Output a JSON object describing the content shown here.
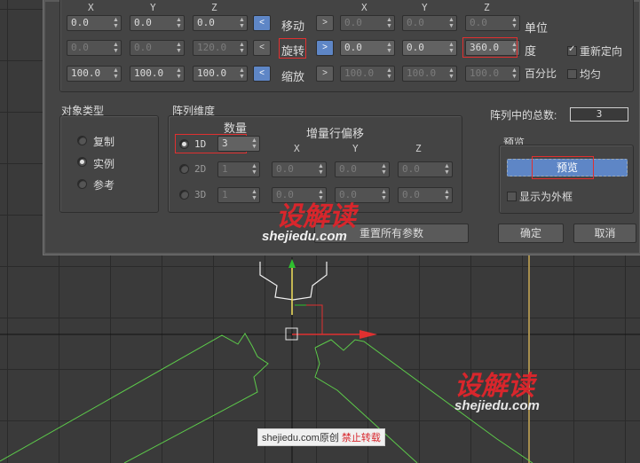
{
  "axes": {
    "x": "X",
    "y": "Y",
    "z": "Z"
  },
  "incremental": {
    "move": {
      "x": "0.0",
      "y": "0.0",
      "z": "0.0"
    },
    "rotate": {
      "x": "0.0",
      "y": "0.0",
      "z": "120.0"
    },
    "scale": {
      "x": "100.0",
      "y": "100.0",
      "z": "100.0"
    }
  },
  "row_labels": {
    "move": "移动",
    "rotate": "旋转",
    "scale": "缩放"
  },
  "arrow_left": "<",
  "arrow_right": ">",
  "totals": {
    "move": {
      "x": "0.0",
      "y": "0.0",
      "z": "0.0"
    },
    "rotate": {
      "x": "0.0",
      "y": "0.0",
      "z": "360.0"
    },
    "scale": {
      "x": "100.0",
      "y": "100.0",
      "z": "100.0"
    }
  },
  "right_labels": {
    "units": "单位",
    "degrees": "度",
    "percent": "百分比",
    "reorient": "重新定向",
    "uniform": "均匀"
  },
  "object_type": {
    "title": "对象类型",
    "copy": "复制",
    "instance": "实例",
    "reference": "参考"
  },
  "array_dims": {
    "title": "阵列维度",
    "count_header": "数量",
    "incr_offset_header": "增量行偏移",
    "rows": [
      {
        "label": "1D",
        "count": "3"
      },
      {
        "label": "2D",
        "count": "1",
        "x": "0.0",
        "y": "0.0",
        "z": "0.0"
      },
      {
        "label": "3D",
        "count": "1",
        "x": "0.0",
        "y": "0.0",
        "z": "0.0"
      }
    ]
  },
  "total_in_array": {
    "label": "阵列中的总数:",
    "value": "3"
  },
  "preview": {
    "title": "预览",
    "button": "预览",
    "show_box": "显示为外框"
  },
  "buttons": {
    "reset": "重置所有参数",
    "ok": "确定",
    "cancel": "取消"
  },
  "watermark": {
    "brand": "设解读",
    "domain": "shejiedu.com",
    "footer_domain": "shejiedu.com原创",
    "footer_note": "禁止转载"
  },
  "colors": {
    "accent": "#5e86c6",
    "highlight": "#e03030",
    "spline": "#66d44a"
  }
}
